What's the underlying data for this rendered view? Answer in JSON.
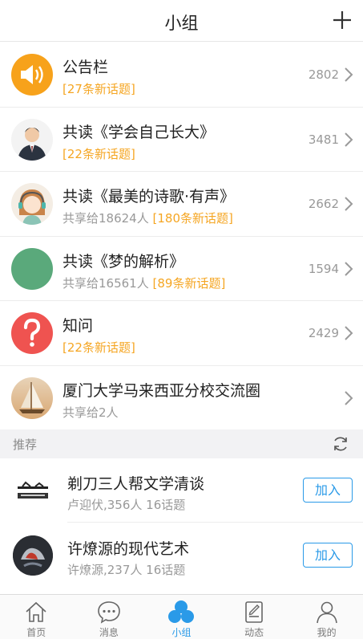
{
  "nav": {
    "title": "小组"
  },
  "groups": [
    {
      "title": "公告栏",
      "share": "",
      "tag": "[27条新话题]",
      "count": "2802"
    },
    {
      "title": "共读《学会自己长大》",
      "share": "",
      "tag": "[22条新话题]",
      "count": "3481"
    },
    {
      "title": "共读《最美的诗歌·有声》",
      "share": "共享给18624人",
      "tag": "[180条新话题]",
      "count": "2662"
    },
    {
      "title": "共读《梦的解析》",
      "share": "共享给16561人",
      "tag": "[89条新话题]",
      "count": "1594"
    },
    {
      "title": "知问",
      "share": "",
      "tag": "[22条新话题]",
      "count": "2429"
    },
    {
      "title": "厦门大学马来西亚分校交流圈",
      "share": "共享给2人",
      "tag": "",
      "count": ""
    }
  ],
  "recommend": {
    "title": "推荐",
    "items": [
      {
        "title": "剃刀三人帮文学清谈",
        "sub": "卢迎伏,356人 16话题",
        "button": "加入"
      },
      {
        "title": "许燎源的现代艺术",
        "sub": "许燎源,237人 16话题",
        "button": "加入"
      }
    ]
  },
  "tabs": [
    {
      "label": "首页",
      "icon": "home-icon"
    },
    {
      "label": "消息",
      "icon": "message-icon"
    },
    {
      "label": "小组",
      "icon": "group-icon",
      "active": true
    },
    {
      "label": "动态",
      "icon": "feed-icon"
    },
    {
      "label": "我的",
      "icon": "profile-icon"
    }
  ],
  "colors": {
    "accent": "#2a9ae8",
    "tag": "#f5a623",
    "announcement": "#f7a21b",
    "qa": "#ef5350",
    "dream": "#5aa97b"
  }
}
